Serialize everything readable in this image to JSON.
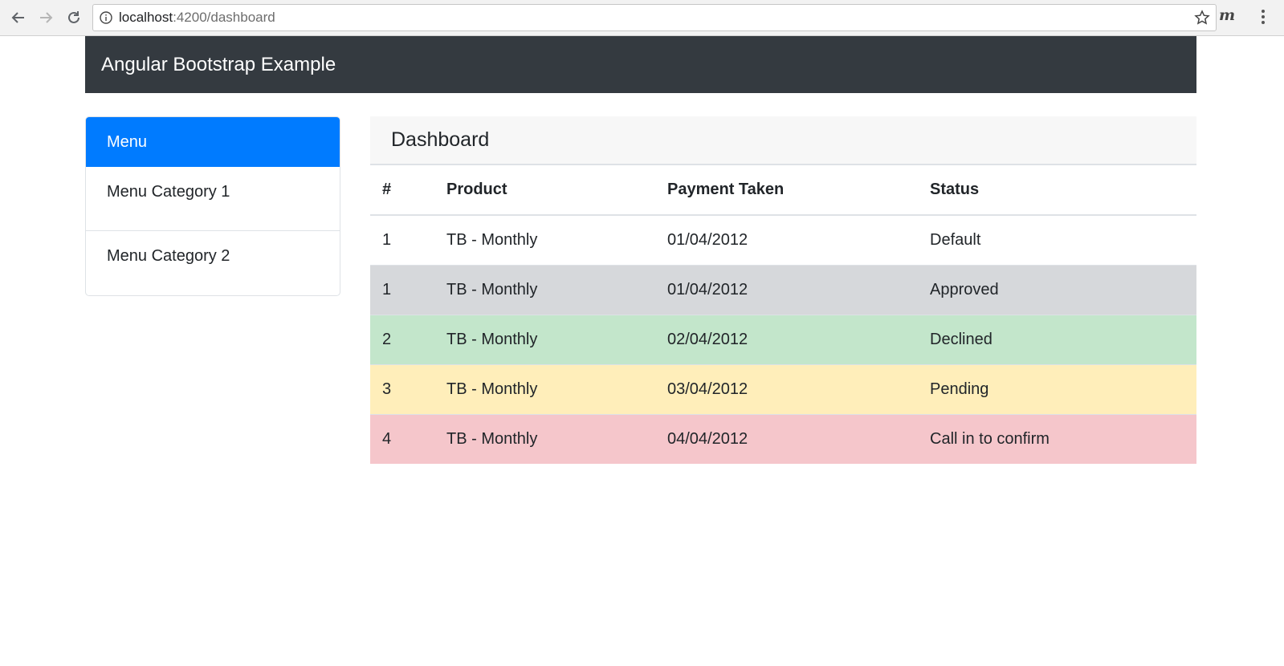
{
  "browser": {
    "url_host": "localhost",
    "url_rest": ":4200/dashboard",
    "extension_label": "m"
  },
  "navbar": {
    "brand": "Angular Bootstrap Example",
    "background": "#343a40"
  },
  "sidebar": {
    "header": "Menu",
    "accent": "#007bff",
    "items": [
      {
        "label": "Menu Category 1"
      },
      {
        "label": "Menu Category 2"
      }
    ]
  },
  "dashboard": {
    "title": "Dashboard",
    "columns": [
      "#",
      "Product",
      "Payment Taken",
      "Status"
    ],
    "rows": [
      {
        "num": "1",
        "product": "TB - Monthly",
        "payment": "01/04/2012",
        "status": "Default",
        "bg": "#ffffff"
      },
      {
        "num": "1",
        "product": "TB - Monthly",
        "payment": "01/04/2012",
        "status": "Approved",
        "bg": "#d6d8db"
      },
      {
        "num": "2",
        "product": "TB - Monthly",
        "payment": "02/04/2012",
        "status": "Declined",
        "bg": "#c3e6cb"
      },
      {
        "num": "3",
        "product": "TB - Monthly",
        "payment": "03/04/2012",
        "status": "Pending",
        "bg": "#ffeeba"
      },
      {
        "num": "4",
        "product": "TB - Monthly",
        "payment": "04/04/2012",
        "status": "Call in to confirm",
        "bg": "#f5c6cb"
      }
    ]
  }
}
